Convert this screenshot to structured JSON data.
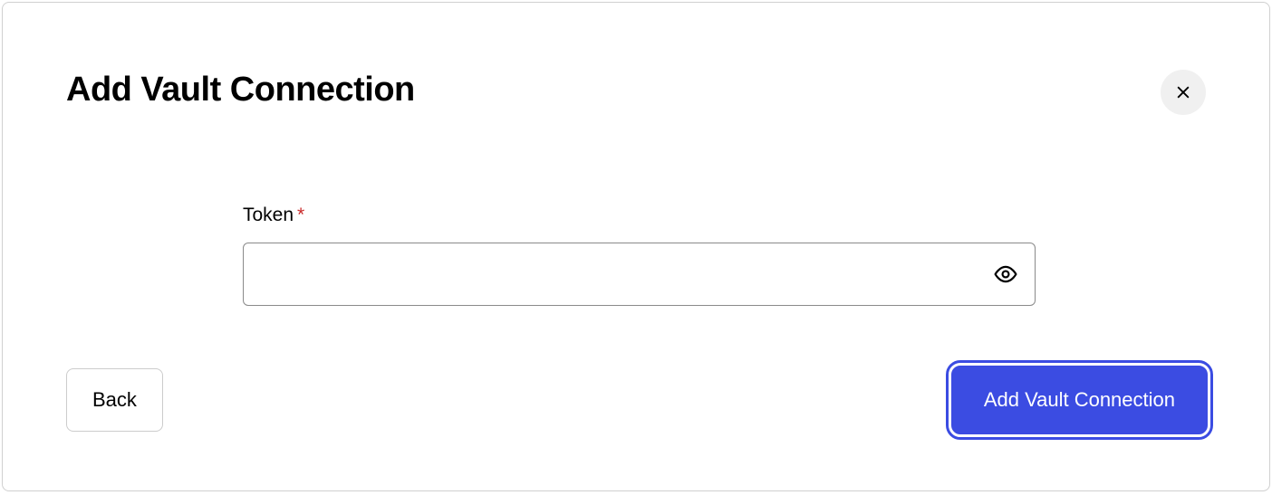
{
  "modal": {
    "title": "Add Vault Connection"
  },
  "form": {
    "token_label": "Token",
    "required_indicator": "*",
    "token_value": ""
  },
  "footer": {
    "back_label": "Back",
    "submit_label": "Add Vault Connection"
  },
  "icons": {
    "close": "close-icon",
    "eye": "eye-icon"
  }
}
